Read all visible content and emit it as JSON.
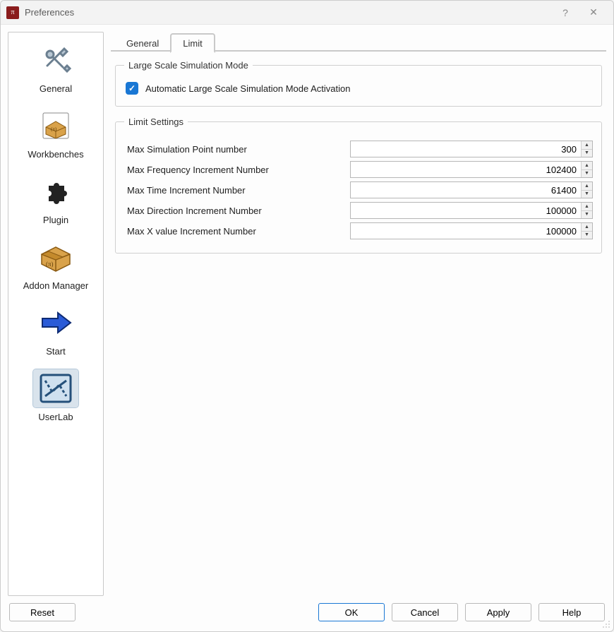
{
  "window": {
    "title": "Preferences"
  },
  "sidebar": {
    "items": [
      {
        "id": "general",
        "label": "General"
      },
      {
        "id": "workbenches",
        "label": "Workbenches"
      },
      {
        "id": "plugin",
        "label": "Plugin"
      },
      {
        "id": "addon",
        "label": "Addon Manager"
      },
      {
        "id": "start",
        "label": "Start"
      },
      {
        "id": "userlab",
        "label": "UserLab"
      }
    ],
    "selected": "userlab"
  },
  "tabs": {
    "items": [
      {
        "id": "general",
        "label": "General"
      },
      {
        "id": "limit",
        "label": "Limit"
      }
    ],
    "active": "limit"
  },
  "group_large_scale": {
    "legend": "Large Scale Simulation Mode",
    "checkbox_label": "Automatic Large Scale Simulation Mode Activation",
    "checkbox_checked": true
  },
  "group_limit": {
    "legend": "Limit Settings",
    "fields": [
      {
        "label": "Max Simulation Point number",
        "value": "300"
      },
      {
        "label": "Max Frequency Increment Number",
        "value": "102400"
      },
      {
        "label": "Max Time Increment Number",
        "value": "61400"
      },
      {
        "label": "Max Direction Increment Number",
        "value": "100000"
      },
      {
        "label": "Max X value Increment Number",
        "value": "100000"
      }
    ]
  },
  "footer": {
    "reset": "Reset",
    "ok": "OK",
    "cancel": "Cancel",
    "apply": "Apply",
    "help": "Help"
  }
}
